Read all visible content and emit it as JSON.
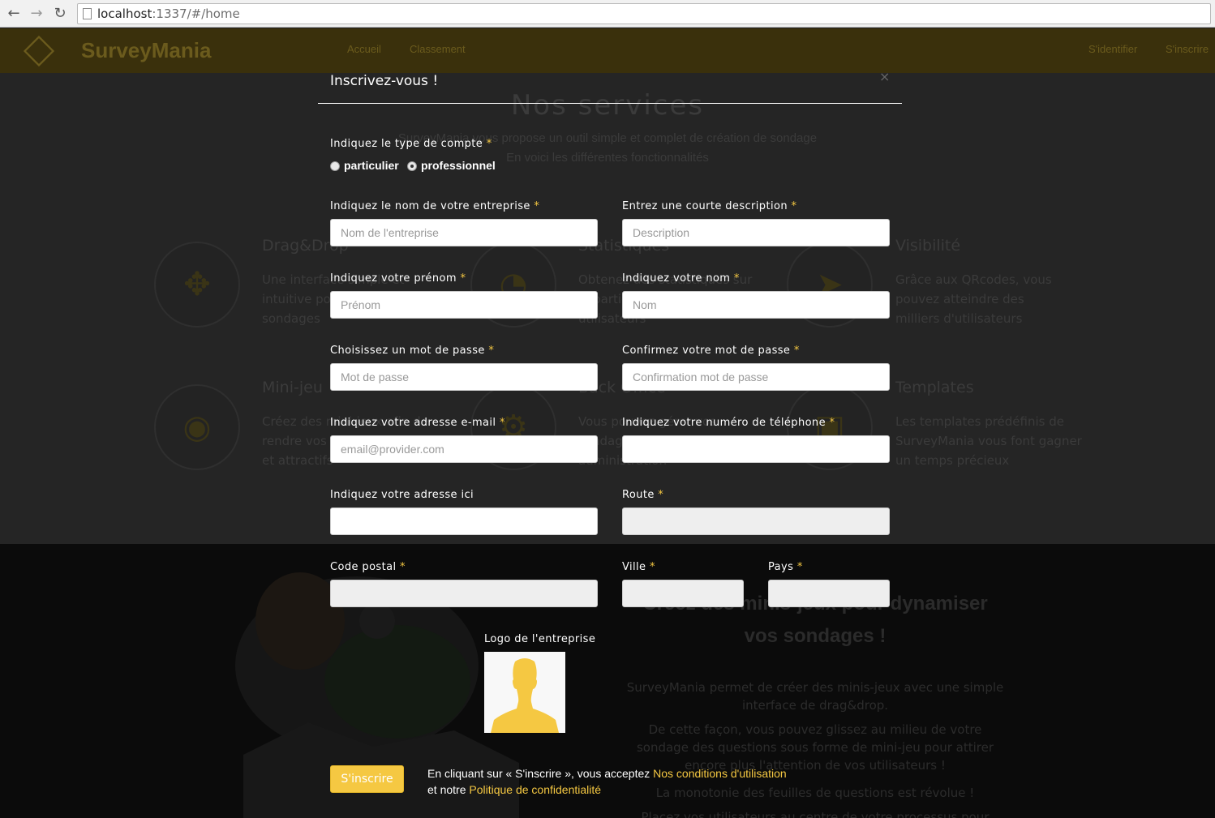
{
  "browser": {
    "url_host": "localhost",
    "url_rest": ":1337/#/home"
  },
  "site": {
    "brand": "SurveyMania",
    "nav": [
      "Accueil",
      "Classement"
    ],
    "nav_right": [
      "S'identifier",
      "S'inscrire"
    ]
  },
  "services": {
    "title": "Nos services",
    "subtitle_1": "SurveyMania vous propose un outil simple et complet de création de sondage",
    "subtitle_2": "En voici les différentes fonctionnalités",
    "items": [
      {
        "title": "Drag&Drop",
        "text": "Une interface simple et intuitive pour créer vos sondages"
      },
      {
        "title": "Statistiques",
        "text": "Obtenez des statistiques sur la participation de vos utilisateurs"
      },
      {
        "title": "Visibilité",
        "text": "Grâce aux QRcodes, vous pouvez atteindre des milliers d'utilisateurs"
      },
      {
        "title": "Mini-jeu",
        "text": "Créez des mini-jeux afin de rendre vos sondages ludiques et attractifs"
      },
      {
        "title": "Back Office",
        "text": "Vous pouvez gérer vos sondages depuis une administration"
      },
      {
        "title": "Templates",
        "text": "Les templates prédéfinis de SurveyMania vous font gagner un temps précieux"
      }
    ]
  },
  "games_section": {
    "title_1": "Créez des minis-jeux pour dynamiser",
    "title_2": "vos sondages !",
    "p1": "SurveyMania permet de créer des minis-jeux avec une simple interface de drag&drop.",
    "p2": "De cette façon, vous pouvez glissez au milieu de votre sondage des questions sous forme de mini-jeu pour attirer encore plus l'attention de vos utilisateurs !",
    "p3": "La monotonie des feuilles de questions est révolue !",
    "p4": "Placez vos utilisateurs au centre de votre processus pour"
  },
  "modal": {
    "title": "Inscrivez-vous !",
    "close": "×",
    "account_type_label": "Indiquez le type de compte",
    "required_mark": "*",
    "radio_particulier": "particulier",
    "radio_professionnel": "professionnel",
    "selected_account_type": "professionnel",
    "company_label": "Indiquez le nom de votre entreprise",
    "company_placeholder": "Nom de l'entreprise",
    "description_label": "Entrez une courte description",
    "description_placeholder": "Description",
    "firstname_label": "Indiquez votre prénom",
    "firstname_placeholder": "Prénom",
    "lastname_label": "Indiquez votre nom",
    "lastname_placeholder": "Nom",
    "password_label": "Choisissez un mot de passe",
    "password_placeholder": "Mot de passe",
    "confirm_label": "Confirmez votre mot de passe",
    "confirm_placeholder": "Confirmation mot de passe",
    "email_label": "Indiquez votre adresse e-mail",
    "email_placeholder": "email@provider.com",
    "phone_label": "Indiquez votre numéro de téléphone",
    "address_label": "Indiquez votre adresse ici",
    "route_label": "Route",
    "postal_label": "Code postal",
    "city_label": "Ville",
    "country_label": "Pays",
    "logo_label": "Logo de l'entreprise",
    "submit_label": "S'inscrire",
    "terms_prefix": "En cliquant sur « S'inscrire », vous acceptez ",
    "terms_link": "Nos conditions d'utilisation",
    "privacy_prefix": "et notre ",
    "privacy_link": "Politique de confidentialité"
  },
  "colors": {
    "accent": "#f5c842",
    "overlay": "#1f1f1f"
  }
}
